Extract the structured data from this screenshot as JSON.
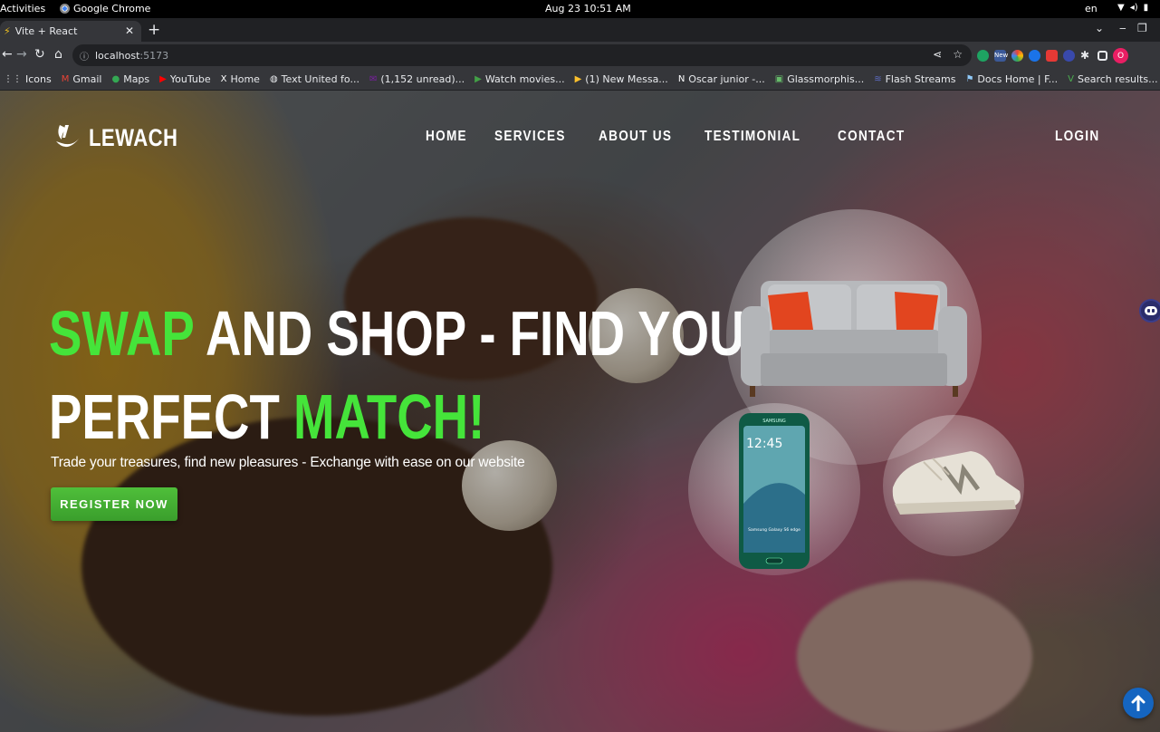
{
  "system": {
    "activities": "Activities",
    "app_name": "Google Chrome",
    "clock": "Aug 23  10:51 AM",
    "language": "en"
  },
  "browser": {
    "tab_title": "Vite + React",
    "url_host": "localhost",
    "url_port": ":5173",
    "profile_initial": "O",
    "extension_badge": "New"
  },
  "bookmarks": [
    {
      "label": "Icons",
      "icon": "apps-icon",
      "color": "#e8eaed"
    },
    {
      "label": "Gmail",
      "icon": "gmail-icon",
      "color": "#ea4335"
    },
    {
      "label": "Maps",
      "icon": "maps-icon",
      "color": "#34a853"
    },
    {
      "label": "YouTube",
      "icon": "youtube-icon",
      "color": "#ff0000"
    },
    {
      "label": "Home",
      "icon": "x-icon",
      "color": "#ffffff"
    },
    {
      "label": "Text United fo...",
      "icon": "globe-icon",
      "color": "#e8eaed"
    },
    {
      "label": "(1,152 unread)...",
      "icon": "yahoo-mail-icon",
      "color": "#7b1fa2"
    },
    {
      "label": "Watch movies...",
      "icon": "play-icon",
      "color": "#43a047"
    },
    {
      "label": "(1) New Messa...",
      "icon": "play-icon",
      "color": "#fbc02d"
    },
    {
      "label": "Oscar junior -...",
      "icon": "notion-icon",
      "color": "#ffffff"
    },
    {
      "label": "Glassmorphis...",
      "icon": "doc-icon",
      "color": "#66bb6a"
    },
    {
      "label": "Flash Streams",
      "icon": "stream-icon",
      "color": "#5c6bc0"
    },
    {
      "label": "Docs Home | F...",
      "icon": "flag-icon",
      "color": "#90caf9"
    },
    {
      "label": "Search results...",
      "icon": "vuetify-icon",
      "color": "#4caf50"
    }
  ],
  "site": {
    "logo_text": "LEWACH",
    "nav": [
      "HOME",
      "SERVICES",
      "ABOUT US",
      "TESTIMONIAL",
      "CONTACT"
    ],
    "login": "LOGIN",
    "headline": {
      "line1_highlight": "SWAP",
      "line1_rest": " AND SHOP - FIND YOUR",
      "line2_start": "PERFECT ",
      "line2_highlight": "MATCH!"
    },
    "tagline": "Trade your treasures, find new pleasures - Exchange with ease on our website",
    "cta": "REGISTER NOW",
    "phone_brand": "SAMSUNG",
    "phone_time": "12:45",
    "phone_model": "Samsung Galaxy S6 edge",
    "accent_color": "#45e43a",
    "button_color": "#43b034"
  }
}
